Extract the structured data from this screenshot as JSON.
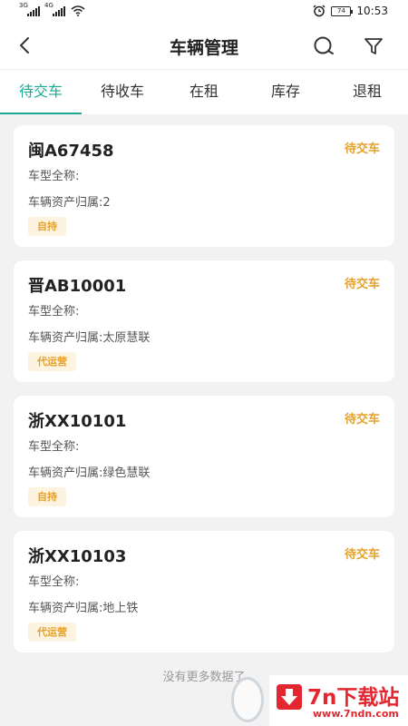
{
  "status_bar": {
    "signal_1_tag": "3G",
    "signal_2_tag": "4G",
    "battery": "74",
    "time": "10:53"
  },
  "header": {
    "title": "车辆管理",
    "back_icon": "back-arrow-icon",
    "search_icon": "search-icon",
    "filter_icon": "filter-icon"
  },
  "tabs": [
    {
      "label": "待交车",
      "active": true
    },
    {
      "label": "待收车",
      "active": false
    },
    {
      "label": "在租",
      "active": false
    },
    {
      "label": "库存",
      "active": false
    },
    {
      "label": "退租",
      "active": false
    }
  ],
  "vehicles": [
    {
      "plate": "闽A67458",
      "status": "待交车",
      "model_line": "车型全称:",
      "asset_line": "车辆资产归属:2",
      "badge": "自持"
    },
    {
      "plate": "晋AB10001",
      "status": "待交车",
      "model_line": "车型全称:",
      "asset_line": "车辆资产归属:太原慧联",
      "badge": "代运营"
    },
    {
      "plate": "浙XX10101",
      "status": "待交车",
      "model_line": "车型全称:",
      "asset_line": "车辆资产归属:绿色慧联",
      "badge": "自持"
    },
    {
      "plate": "浙XX10103",
      "status": "待交车",
      "model_line": "车型全称:",
      "asset_line": "车辆资产归属:地上铁",
      "badge": "代运营"
    }
  ],
  "footer_text": "没有更多数据了",
  "watermark": {
    "text": "7n下载站",
    "url": "www.7ndn.com"
  },
  "colors": {
    "accent": "#1aaa95",
    "status": "#e6a12a",
    "badge_bg": "#fdf3e1",
    "watermark": "#e3262f"
  }
}
